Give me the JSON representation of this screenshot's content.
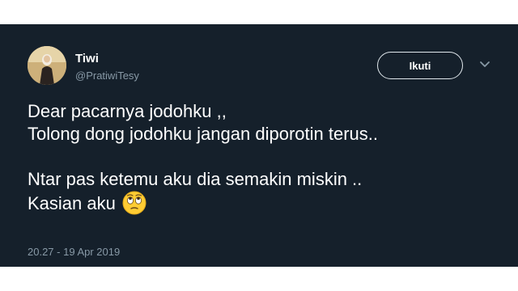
{
  "user": {
    "display_name": "Tiwi",
    "handle": "@PratiwiTesy"
  },
  "actions": {
    "follow_label": "Ikuti",
    "menu_icon": "chevron-down-icon"
  },
  "tweet": {
    "lines": [
      "Dear pacarnya jodohku ,,",
      "Tolong dong jodohku jangan diporotin terus..",
      "Ntar pas ketemu aku dia semakin miskin ..",
      "Kasian aku"
    ],
    "emoji": "face-with-rolling-eyes-icon",
    "timestamp": "20.27 - 19 Apr 2019"
  },
  "colors": {
    "card_background": "#15202b",
    "primary_text": "#ffffff",
    "secondary_text": "#8899a6",
    "emoji_yellow": "#ffcc33"
  }
}
